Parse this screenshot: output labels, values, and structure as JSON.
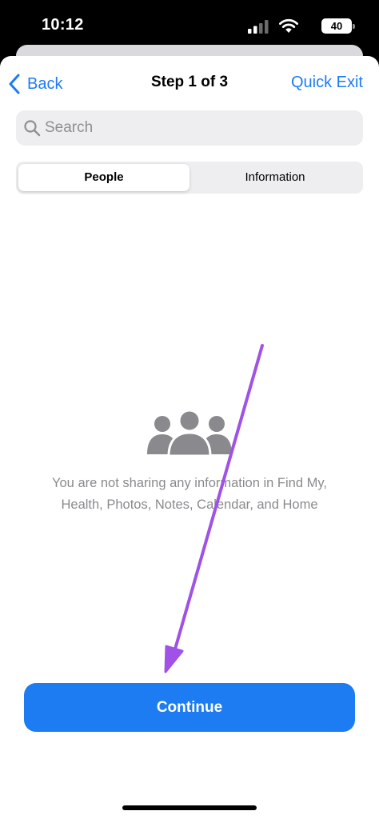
{
  "status_bar": {
    "time": "10:12",
    "battery": "40"
  },
  "nav": {
    "back_label": "Back",
    "title": "Step 1 of 3",
    "quick_exit_label": "Quick Exit"
  },
  "search": {
    "placeholder": "Search",
    "value": ""
  },
  "segments": [
    {
      "label": "People",
      "selected": true
    },
    {
      "label": "Information",
      "selected": false
    }
  ],
  "empty_state": {
    "icon": "people-icon",
    "message": "You are not sharing any information in Find My, Health, Photos, Notes, Calendar, and Home"
  },
  "continue_label": "Continue",
  "colors": {
    "accent": "#1d7cf2",
    "annotation_arrow": "#a052e8",
    "secondary_text": "#8a8a8e"
  },
  "icons": [
    "chevron-left-icon",
    "search-icon",
    "people-icon",
    "signal-icon",
    "wifi-icon",
    "battery-icon"
  ]
}
